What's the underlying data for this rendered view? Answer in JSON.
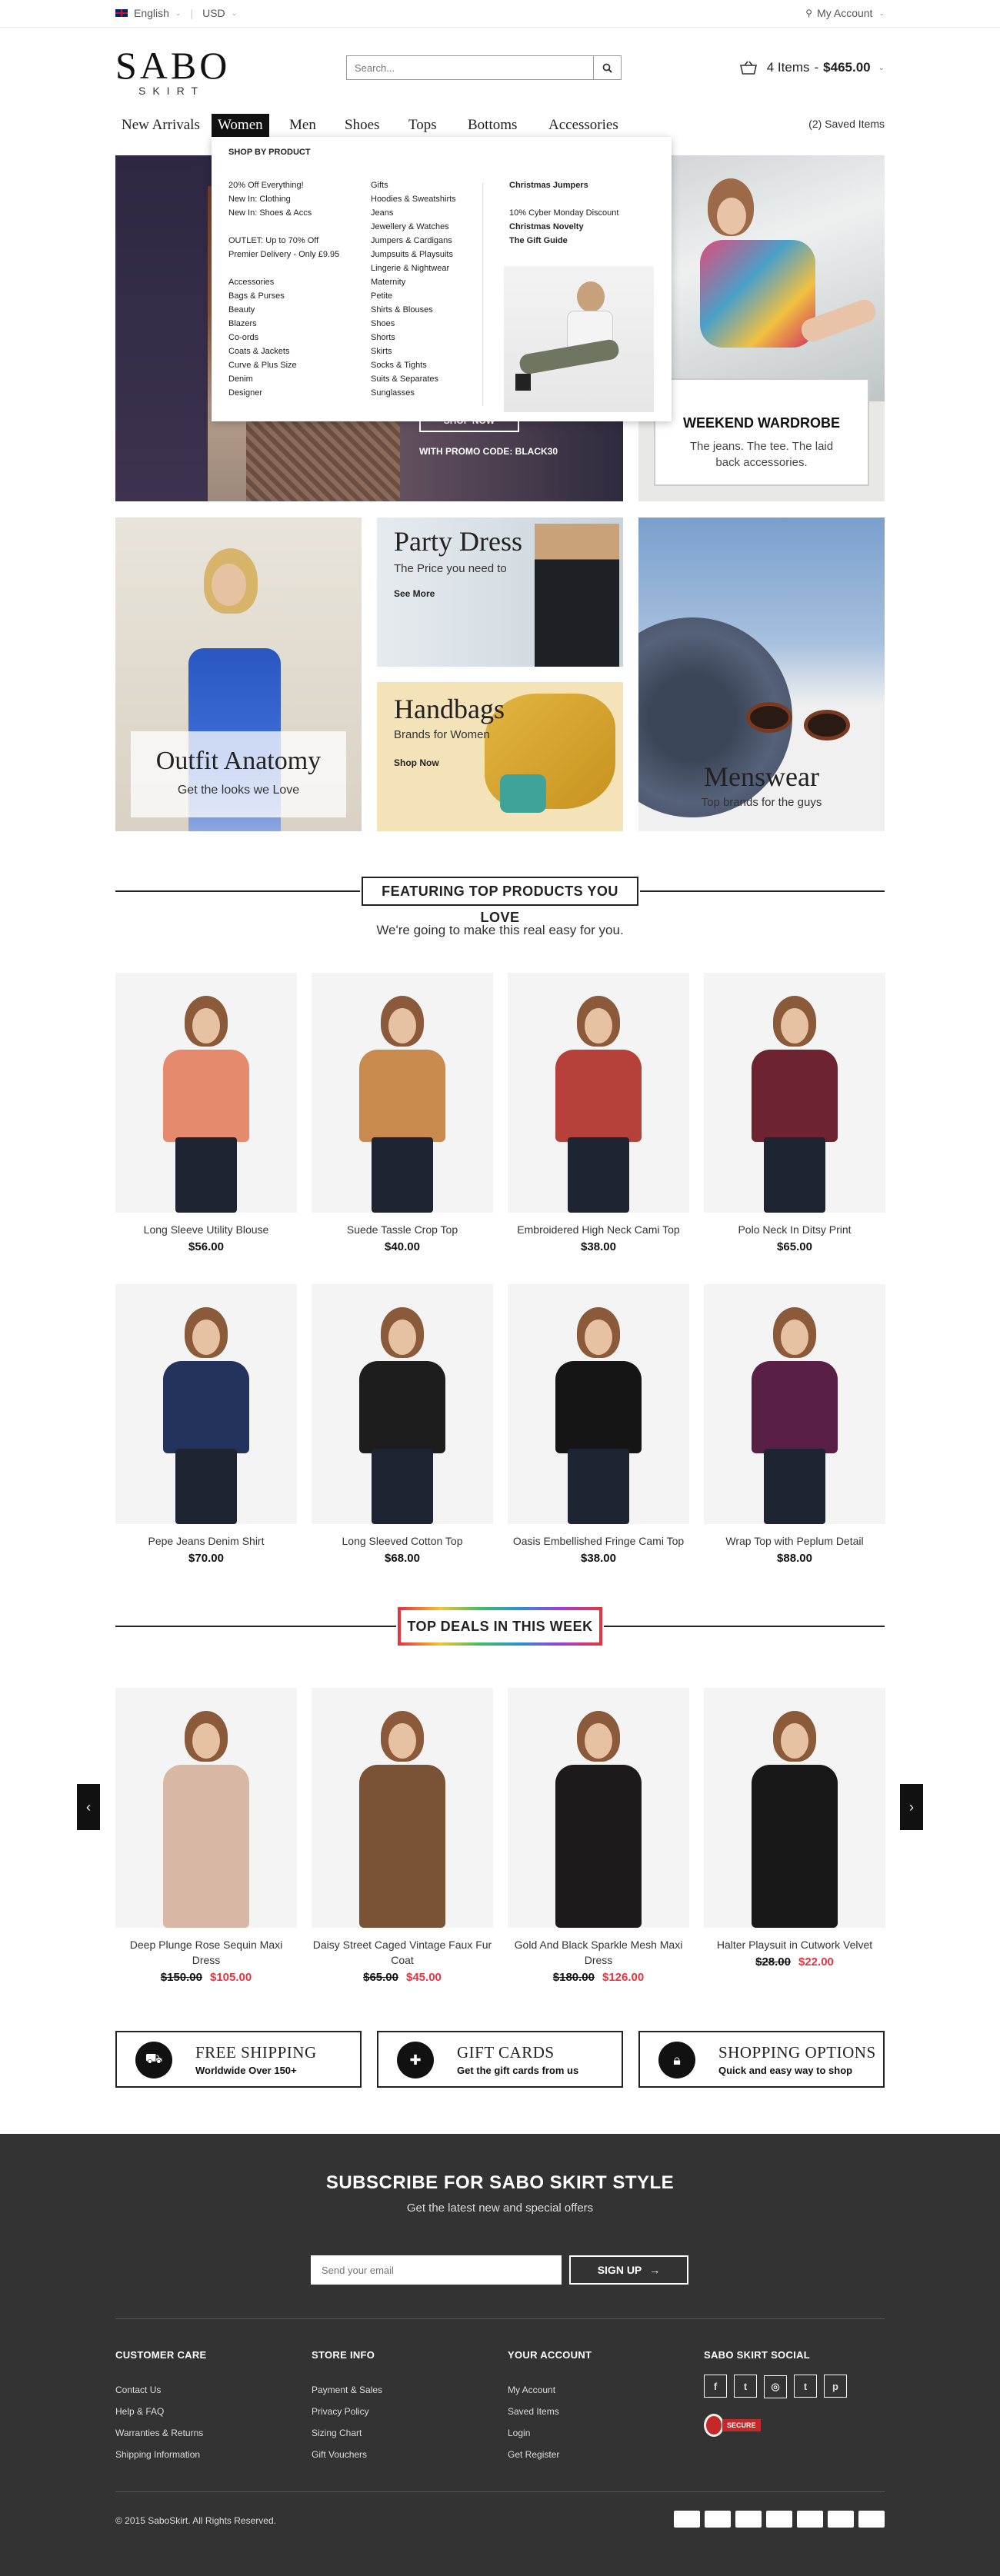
{
  "topbar": {
    "language": "English",
    "currency": "USD",
    "account": "My Account"
  },
  "header": {
    "logo_main": "SABO",
    "logo_sub": "SKIRT",
    "search_placeholder": "Search...",
    "cart_items": "4 Items",
    "cart_total": "$465.00"
  },
  "nav": {
    "items": [
      "New Arrivals",
      "Women",
      "Men",
      "Shoes",
      "Tops",
      "Bottoms",
      "Accessories"
    ],
    "active": "Women",
    "saved": "(2) Saved Items"
  },
  "mega_menu": {
    "heading": "SHOP BY PRODUCT",
    "col1": [
      "20% Off Everything!",
      "New In: Clothing",
      "New In: Shoes & Accs",
      "",
      "OUTLET: Up to 70% Off",
      "Premier Delivery - Only £9.95",
      "",
      "Accessories",
      "Bags & Purses",
      "Beauty",
      "Blazers",
      "Co-ords",
      "Coats & Jackets",
      "Curve & Plus Size",
      "Denim",
      "Designer"
    ],
    "col2": [
      "Gifts",
      "Hoodies & Sweatshirts",
      "Jeans",
      "Jewellery & Watches",
      "Jumpers & Cardigans",
      "Jumpsuits & Playsuits",
      "Lingerie & Nightwear",
      "Maternity",
      "Petite",
      "Shirts & Blouses",
      "Shoes",
      "Shorts",
      "Skirts",
      "Socks & Tights",
      "Suits & Separates",
      "Sunglasses"
    ],
    "col3_title": "Christmas Jumpers",
    "col3": [
      "10% Cyber Monday Discount",
      "Christmas Novelty",
      "The Gift Guide"
    ]
  },
  "hero": {
    "promo_button": "SHOP NOW",
    "promo_code": "WITH PROMO CODE: BLACK30",
    "weekend_title": "WEEKEND WARDROBE",
    "weekend_text": "The jeans. The tee. The laid back accessories."
  },
  "banners": {
    "outfit_title": "Outfit Anatomy",
    "outfit_sub": "Get the looks we Love",
    "party_title": "Party Dress",
    "party_sub": "The Price you need to",
    "party_link": "See More",
    "handbags_title": "Handbags",
    "handbags_sub": "Brands for Women",
    "handbags_link": "Shop Now",
    "menswear_title": "Menswear",
    "menswear_sub": "Top brands for the guys"
  },
  "featured": {
    "heading": "FEATURING TOP PRODUCTS YOU LOVE",
    "subheading": "We're going to make this real easy for you.",
    "products": [
      {
        "name": "Long Sleeve Utility Blouse",
        "price": "$56.00",
        "color": "#e58a6d"
      },
      {
        "name": "Suede Tassle Crop Top",
        "price": "$40.00",
        "color": "#c98b4d"
      },
      {
        "name": "Embroidered High Neck Cami Top",
        "price": "$38.00",
        "color": "#b5413a"
      },
      {
        "name": "Polo Neck In Ditsy Print",
        "price": "$65.00",
        "color": "#6e2331"
      },
      {
        "name": "Pepe Jeans Denim Shirt",
        "price": "$70.00",
        "color": "#24325e"
      },
      {
        "name": "Long Sleeved Cotton Top",
        "price": "$68.00",
        "color": "#1d1d1d"
      },
      {
        "name": "Oasis Embellished Fringe Cami Top",
        "price": "$38.00",
        "color": "#151515"
      },
      {
        "name": "Wrap Top with Peplum Detail",
        "price": "$88.00",
        "color": "#5a1f45"
      }
    ]
  },
  "deals": {
    "heading": "TOP DEALS IN THIS WEEK",
    "products": [
      {
        "name": "Deep Plunge Rose Sequin Maxi Dress",
        "old": "$150.00",
        "sale": "$105.00",
        "color": "#d9b7a5"
      },
      {
        "name": "Daisy Street Caged Vintage Faux Fur Coat",
        "old": "$65.00",
        "sale": "$45.00",
        "color": "#7a5236"
      },
      {
        "name": "Gold And Black Sparkle Mesh Maxi Dress",
        "old": "$180.00",
        "sale": "$126.00",
        "color": "#1c1a1a"
      },
      {
        "name": "Halter Playsuit in Cutwork Velvet",
        "old": "$28.00",
        "sale": "$22.00",
        "color": "#181818"
      }
    ]
  },
  "features": [
    {
      "title": "FREE SHIPPING",
      "sub": "Worldwide Over 150+",
      "icon": "truck-icon"
    },
    {
      "title": "GIFT CARDS",
      "sub": "Get the gift cards from us",
      "icon": "gift-icon"
    },
    {
      "title": "SHOPPING OPTIONS",
      "sub": "Quick and easy way to shop",
      "icon": "lock-icon"
    }
  ],
  "footer": {
    "subscribe_title": "SUBSCRIBE FOR SABO SKIRT STYLE",
    "subscribe_sub": "Get the latest new and special offers",
    "email_placeholder": "Send your email",
    "signup_label": "SIGN UP",
    "columns": [
      {
        "title": "CUSTOMER CARE",
        "links": [
          "Contact Us",
          "Help & FAQ",
          "Warranties & Returns",
          "Shipping Information"
        ]
      },
      {
        "title": "STORE INFO",
        "links": [
          "Payment & Sales",
          "Privacy Policy",
          "Sizing Chart",
          "Gift Vouchers"
        ]
      },
      {
        "title": "YOUR ACCOUNT",
        "links": [
          "My Account",
          "Saved Items",
          "Login",
          "Get Register"
        ]
      }
    ],
    "social_title": "SABO SKIRT SOCIAL",
    "social": [
      "f",
      "t",
      "◎",
      "t",
      "p"
    ],
    "secure_label": "SECURE",
    "copyright": "© 2015 SaboSkirt. All Rights Reserved.",
    "payment_colors": [
      "#1a4fa0",
      "#e53b2c",
      "#0e3b8c",
      "#2e77bc",
      "#1b5fa8",
      "#3c4fa0",
      "#2a7fd4"
    ]
  },
  "colors": {
    "accent_sale": "#e8333f",
    "footer_bg": "#333333"
  }
}
